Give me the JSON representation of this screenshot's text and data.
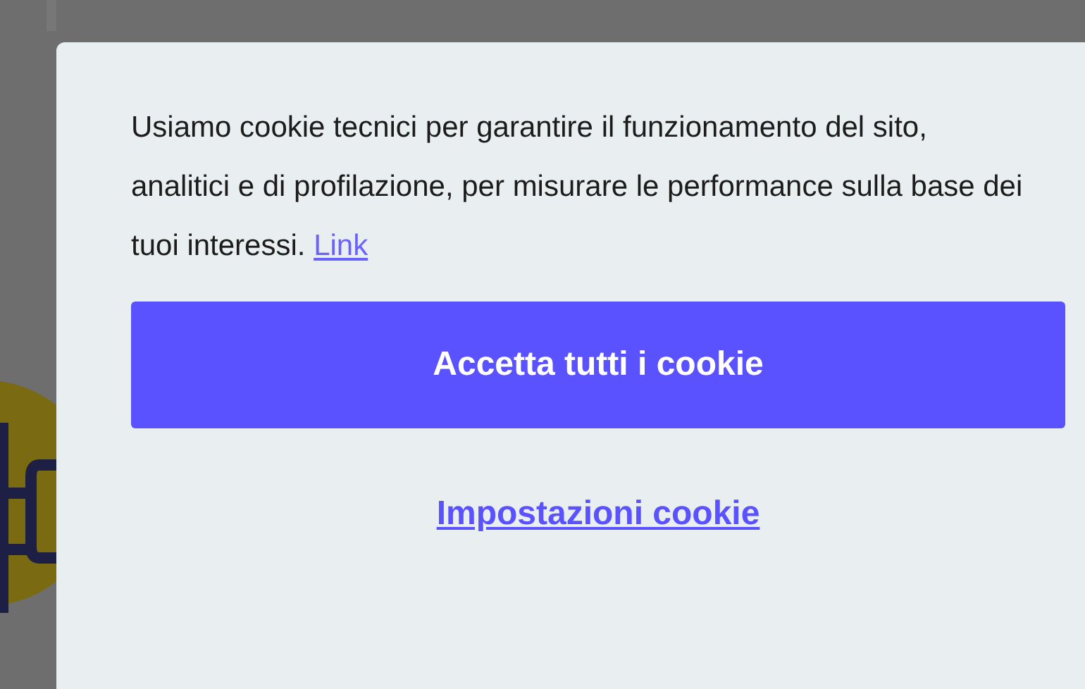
{
  "cookie_banner": {
    "message": "Usiamo cookie tecnici per garantire il funzionamento del sito, analitici e di profilazione, per misurare le performance sulla base dei tuoi interessi.",
    "message_link": "Link",
    "accept_button": "Accetta tutti i cookie",
    "settings_link": "Impostazioni cookie"
  }
}
